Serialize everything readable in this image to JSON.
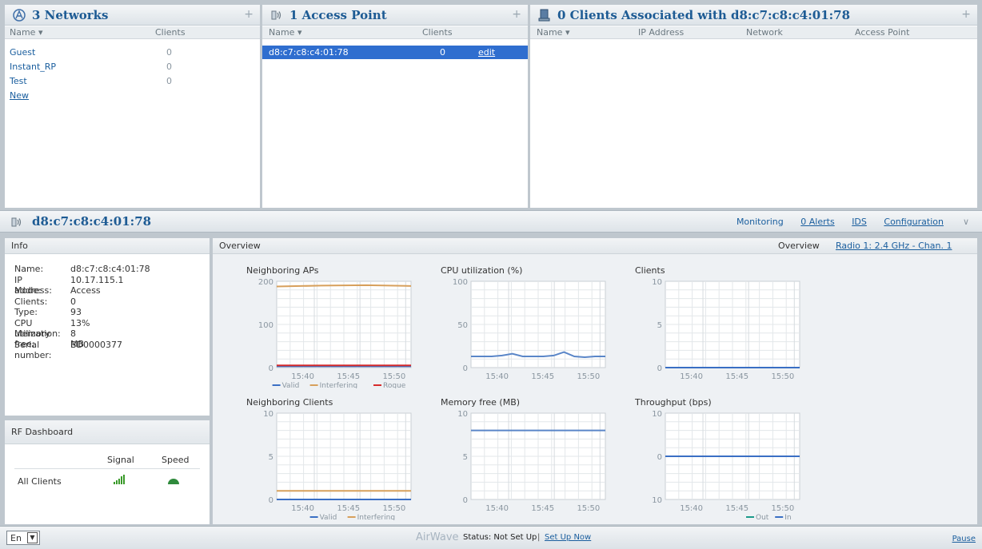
{
  "networks": {
    "title": "3 Networks",
    "col_name": "Name",
    "col_clients": "Clients",
    "rows": [
      {
        "name": "Guest",
        "clients": "0"
      },
      {
        "name": "Instant_RP",
        "clients": "0"
      },
      {
        "name": "Test",
        "clients": "0"
      }
    ],
    "new_link": "New"
  },
  "access_points": {
    "title": "1 Access Point",
    "col_name": "Name",
    "col_clients": "Clients",
    "row": {
      "name": "d8:c7:c8:c4:01:78",
      "clients": "0",
      "edit": "edit"
    }
  },
  "clients": {
    "title": "0 Clients Associated with d8:c7:c8:c4:01:78",
    "col_name": "Name",
    "col_ip": "IP Address",
    "col_network": "Network",
    "col_ap": "Access Point"
  },
  "ap_bar": {
    "title": "d8:c7:c8:c4:01:78",
    "links": [
      "Monitoring",
      "0 Alerts",
      "IDS",
      "Configuration"
    ]
  },
  "info": {
    "header": "Info",
    "rows": [
      {
        "k": "Name:",
        "v": "d8:c7:c8:c4:01:78"
      },
      {
        "k": "IP address:",
        "v": "10.17.115.1"
      },
      {
        "k": "Mode:",
        "v": "Access"
      },
      {
        "k": "Clients:",
        "v": "0"
      },
      {
        "k": "Type:",
        "v": "93"
      },
      {
        "k": "CPU utilization:",
        "v": "13%"
      },
      {
        "k": "Memory free:",
        "v": "8 MB"
      },
      {
        "k": "Serial number:",
        "v": "BD0000377"
      }
    ]
  },
  "rf": {
    "header": "RF Dashboard",
    "col_signal": "Signal",
    "col_speed": "Speed",
    "row_label": "All Clients",
    "signal_color": "#3a9a2a",
    "speed_color": "#2f8a3c"
  },
  "overview": {
    "header": "Overview",
    "right_label": "Overview",
    "radio_link": "Radio 1: 2.4 GHz - Chan. 1"
  },
  "chart_data": [
    {
      "type": "line",
      "title": "Neighboring APs",
      "x": [
        "15:40",
        "15:45",
        "15:50"
      ],
      "ylim": [
        0,
        200
      ],
      "yticks": [
        "200",
        "100",
        "0"
      ],
      "series": [
        {
          "name": "Valid",
          "color": "#3a6fc4",
          "values": [
            3,
            3,
            3,
            3
          ]
        },
        {
          "name": "Interfering",
          "color": "#d7a05c",
          "values": [
            188,
            190,
            191,
            189
          ]
        },
        {
          "name": "Rogue",
          "color": "#d62b2b",
          "values": [
            5,
            5,
            5,
            5
          ]
        }
      ]
    },
    {
      "type": "line",
      "title": "CPU utilization  (%)",
      "x": [
        "15:40",
        "15:45",
        "15:50"
      ],
      "ylim": [
        0,
        100
      ],
      "yticks": [
        "100",
        "50",
        "0"
      ],
      "series": [
        {
          "name": "",
          "color": "#5a86c8",
          "values": [
            13,
            13,
            13,
            14,
            16,
            13,
            13,
            13,
            14,
            18,
            13,
            12,
            13,
            13
          ]
        }
      ]
    },
    {
      "type": "line",
      "title": "Clients",
      "x": [
        "15:40",
        "15:45",
        "15:50"
      ],
      "ylim": [
        0,
        10
      ],
      "yticks": [
        "10",
        "5",
        "0"
      ],
      "series": [
        {
          "name": "",
          "color": "#3a6fc4",
          "values": [
            0,
            0,
            0,
            0
          ]
        }
      ]
    },
    {
      "type": "line",
      "title": "Neighboring Clients",
      "x": [
        "15:40",
        "15:45",
        "15:50"
      ],
      "ylim": [
        0,
        10
      ],
      "yticks": [
        "10",
        "5",
        "0"
      ],
      "series": [
        {
          "name": "Valid",
          "color": "#3a6fc4",
          "values": [
            0,
            0,
            0,
            0
          ]
        },
        {
          "name": "Interfering",
          "color": "#d7a05c",
          "values": [
            1,
            1,
            1,
            1
          ]
        }
      ]
    },
    {
      "type": "line",
      "title": "Memory free  (MB)",
      "x": [
        "15:40",
        "15:45",
        "15:50"
      ],
      "ylim": [
        0,
        10
      ],
      "yticks": [
        "10",
        "5",
        "0"
      ],
      "series": [
        {
          "name": "",
          "color": "#5a86c8",
          "values": [
            8,
            8,
            8,
            8
          ]
        }
      ]
    },
    {
      "type": "line",
      "title": "Throughput  (bps)",
      "x": [
        "15:40",
        "15:45",
        "15:50"
      ],
      "ylim": [
        -10,
        10
      ],
      "yticks": [
        "10",
        "0",
        "10"
      ],
      "series": [
        {
          "name": "Out",
          "color": "#1a9a8a",
          "values": [
            0,
            0,
            0,
            0
          ]
        },
        {
          "name": "In",
          "color": "#3a6fc4",
          "values": [
            0,
            0,
            0,
            0
          ]
        }
      ]
    }
  ],
  "footer": {
    "lang": "En",
    "brand": "AirWave",
    "status": "Status: Not Set Up",
    "sep": "|",
    "setup_link": "Set Up Now",
    "pause": "Pause"
  }
}
